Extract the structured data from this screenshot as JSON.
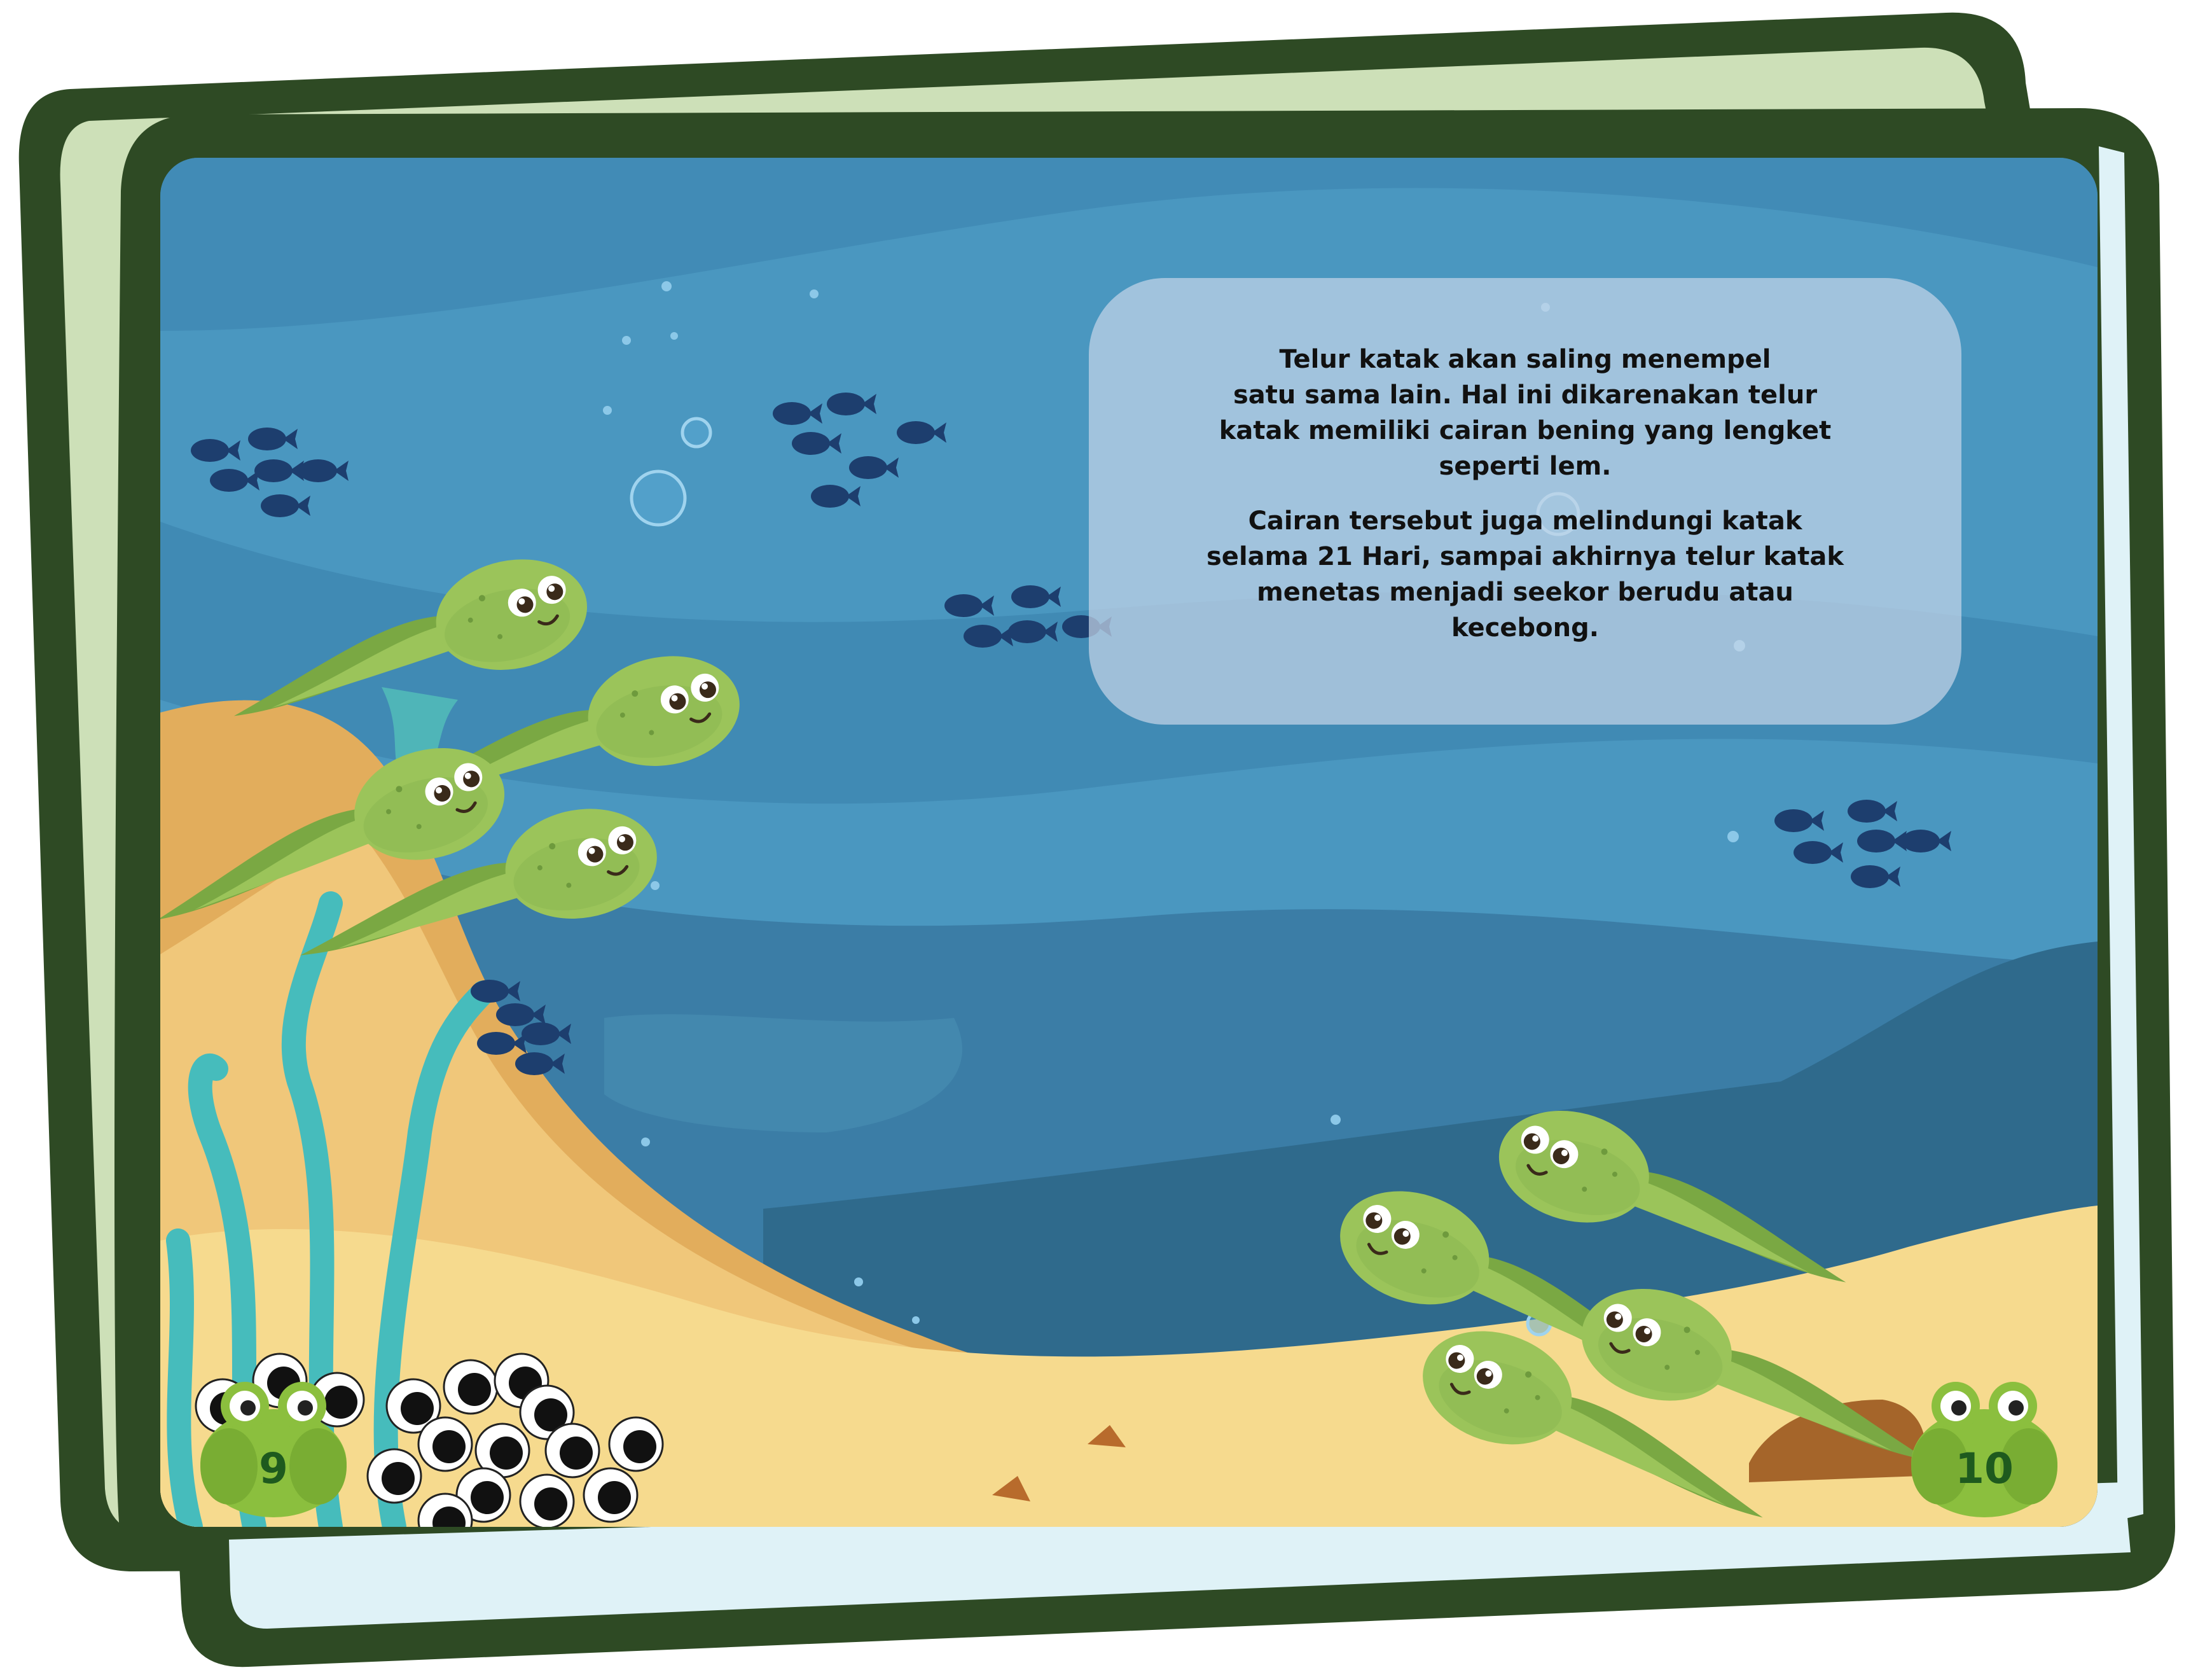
{
  "book": {
    "colors": {
      "outline": "#2e4a24",
      "page_back": "#cde0b8",
      "page_back_right": "#dff2f7",
      "water_light": "#4a97c0",
      "water_dark": "#3b7da6",
      "water_deep": "#2f6a8c",
      "sand": "#f6da8e",
      "sand_dark": "#e2ad5c",
      "tadpole": "#9bc45a",
      "tadpole_dark": "#6e9a3d",
      "seaweed": "#46bcbc",
      "fish": "#1d3e6e"
    },
    "text_box": {
      "paragraph_1": [
        "Telur katak akan saling menempel",
        "satu sama lain. Hal ini dikarenakan telur",
        "katak memiliki cairan bening yang lengket",
        "seperti lem."
      ],
      "paragraph_2": [
        "Cairan tersebut juga melindungi katak",
        "selama 21 Hari, sampai akhirnya telur katak",
        "menetas menjadi seekor berudu atau",
        "kecebong."
      ]
    },
    "page_numbers": {
      "left": "9",
      "right": "10"
    },
    "icons": {
      "frog_badge": "frog-icon",
      "tadpole": "tadpole-icon",
      "fish": "fish-icon",
      "bubble": "bubble-icon",
      "egg": "frog-egg-icon"
    }
  }
}
